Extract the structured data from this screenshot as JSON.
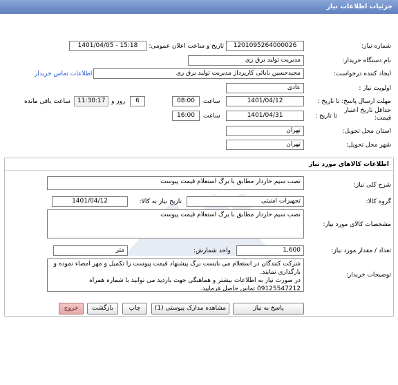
{
  "header": {
    "title": "جزئیات اطلاعات نیاز"
  },
  "form": {
    "need_number": {
      "label": "شماره نیاز:",
      "value": "1201095264000026"
    },
    "announce": {
      "label": "تاریخ و ساعت اعلان عمومی:",
      "value": "1401/04/05 - 15:18"
    },
    "buyer": {
      "label": "نام دستگاه خریدار:",
      "value": "مدیریت تولید برق ری"
    },
    "requester": {
      "label": "ایجاد کننده درخواست:",
      "value": "مجیدحسین بابائی کارپرداز مدیریت تولید برق ری",
      "contact_link": "اطلاعات تماس خریدار"
    },
    "priority": {
      "label": "اولویت نیاز :",
      "value": "عادی"
    },
    "send_deadline": {
      "label": "مهلت ارسال پاسخ: تا تاریخ :",
      "date": "1401/04/12",
      "time_label": "ساعت",
      "time": "08:00",
      "days": "6",
      "days_label": "روز و",
      "remaining": "11:30:17",
      "remaining_label": "ساعت باقی مانده"
    },
    "validity": {
      "label_line1": "حداقل تاریخ اعتبار",
      "label_line2": "قیمت:",
      "to_date_label": "تا تاریخ :",
      "date": "1401/04/31",
      "time_label": "ساعت",
      "time": "16:00"
    },
    "delivery_province": {
      "label": "استان محل تحویل:",
      "value": "تهران"
    },
    "delivery_city": {
      "label": "شهر محل تحویل:",
      "value": "تهران"
    }
  },
  "items": {
    "title": "اطلاعات کالاهای مورد نیاز",
    "general_desc": {
      "label": "شرح کلی نیاز:",
      "value": "نصب سیم خاردار مطابق با برگ استعلام قیمت پیوست"
    },
    "group": {
      "label": "گروه کالا:",
      "value": "تجهیزات امنیتی",
      "need_date_label": "تاریخ نیاز به کالا:",
      "need_date": "1401/04/12"
    },
    "specs": {
      "label": "مشخصات کالای مورد نیاز:",
      "value": "نصب سیم خاردار مطابق با برگ استعلام قیمت پیوست"
    },
    "quantity": {
      "label": "تعداد / مقدار مورد نیاز:",
      "value": "1,600",
      "unit_label": "واحد شمارش:",
      "unit": "متر"
    },
    "buyer_notes": {
      "label": "توضیحات خریدار:",
      "lines": [
        "شرکت کنندگان در استعلام می بایست برگ پیشنهاد قیمت پیوست را تکمیل و مهر امضاء نموده و بارگذاری نمایند.",
        "در صورت نیاز به اطلاعات بیشتر و هماهنگی جهت بازدید  می توانید با شماره همراه 09125547212 تماس حاصل فرمایید."
      ]
    }
  },
  "buttons": {
    "respond": "پاسخ به نیاز",
    "attachments": "مشاهده مدارک پیوستی (1)",
    "print": "چاپ",
    "back": "بازگشت",
    "exit": "خروج"
  },
  "watermark": {
    "line1": "ParsNamadData",
    "line2": "مرکز فراوری اطلاعات پارس نماد داده ها"
  }
}
